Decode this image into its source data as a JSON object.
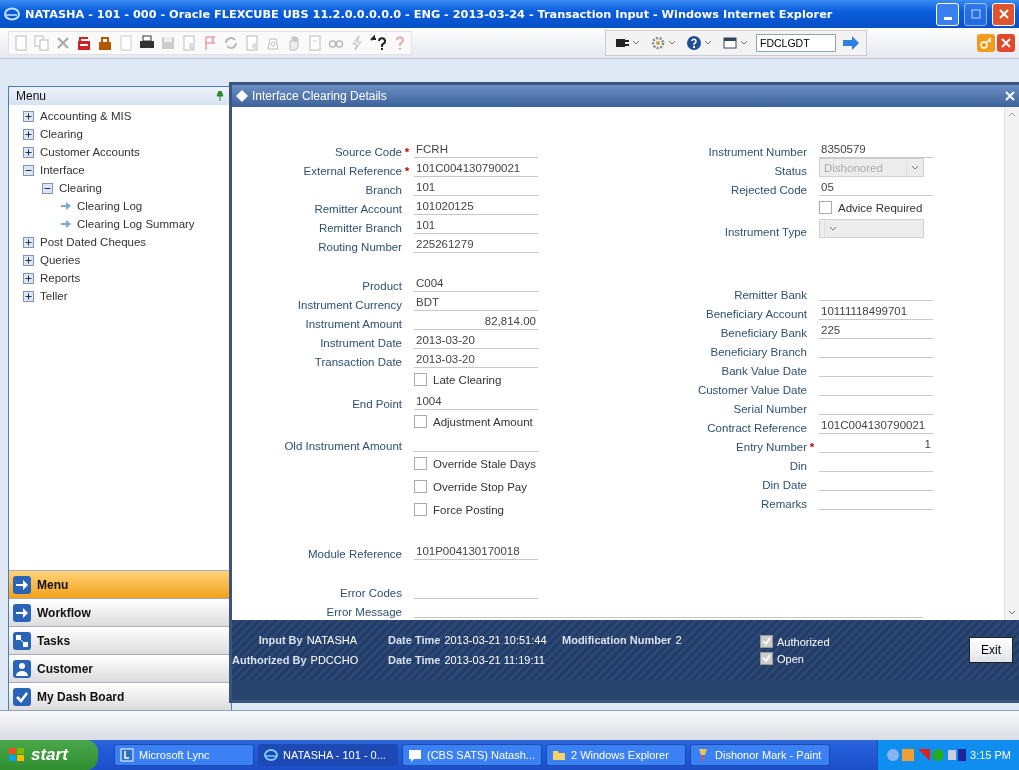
{
  "window": {
    "title": "NATASHA - 101 - 000 - Oracle FLEXCUBE UBS 11.2.0.0.0.0.0 - ENG - 2013-03-24 - Transaction Input - Windows Internet Explorer"
  },
  "toolbar": {
    "function_id": "FDCLGDT"
  },
  "sidebar": {
    "title": "Menu",
    "items": [
      {
        "label": "Accounting & MIS",
        "kind": "folder",
        "expanded": false
      },
      {
        "label": "Clearing",
        "kind": "folder",
        "expanded": false
      },
      {
        "label": "Customer Accounts",
        "kind": "folder",
        "expanded": false
      },
      {
        "label": "Interface",
        "kind": "folder",
        "expanded": true,
        "children": [
          {
            "label": "Clearing",
            "kind": "folder",
            "expanded": true,
            "children": [
              {
                "label": "Clearing Log",
                "kind": "leaf"
              },
              {
                "label": "Clearing Log Summary",
                "kind": "leaf"
              }
            ]
          }
        ]
      },
      {
        "label": "Post Dated Cheques",
        "kind": "folder",
        "expanded": false
      },
      {
        "label": "Queries",
        "kind": "folder",
        "expanded": false
      },
      {
        "label": "Reports",
        "kind": "folder",
        "expanded": false
      },
      {
        "label": "Teller",
        "kind": "folder",
        "expanded": false
      }
    ],
    "nav": [
      {
        "label": "Menu",
        "kind": "arrow",
        "selected": true
      },
      {
        "label": "Workflow",
        "kind": "arrow",
        "selected": false
      },
      {
        "label": "Tasks",
        "kind": "tasks",
        "selected": false
      },
      {
        "label": "Customer",
        "kind": "person",
        "selected": false
      },
      {
        "label": "My Dash Board",
        "kind": "check",
        "selected": false
      }
    ]
  },
  "dialog": {
    "title": "Interface Clearing Details",
    "form": {
      "left": [
        [
          {
            "label": "Source Code",
            "kind": "text",
            "required_mark": "*",
            "value": "FCRH"
          },
          {
            "label": "External Reference",
            "kind": "text",
            "required_mark": "*",
            "value": "101C004130790021"
          },
          {
            "label": "Branch",
            "kind": "text",
            "value": "101"
          },
          {
            "label": "Remitter Account",
            "kind": "text",
            "value": "101020125"
          },
          {
            "label": "Remitter Branch",
            "kind": "text",
            "value": "101"
          },
          {
            "label": "Routing Number",
            "kind": "text",
            "value": "225261279"
          }
        ],
        [
          {
            "label": "Product",
            "kind": "text",
            "value": "C004"
          },
          {
            "label": "Instrument Currency",
            "kind": "text",
            "value": "BDT"
          },
          {
            "label": "Instrument Amount",
            "kind": "amount",
            "value": "82,814.00"
          },
          {
            "label": "Instrument Date",
            "kind": "text",
            "value": "2013-03-20"
          },
          {
            "label": "Transaction Date",
            "kind": "text",
            "value": "2013-03-20"
          },
          {
            "label": "Late Clearing",
            "kind": "checkbox",
            "checked": false
          },
          {
            "label": "End Point",
            "kind": "text",
            "value": "1004"
          },
          {
            "label": "Adjustment Amount",
            "kind": "checkbox",
            "checked": false
          },
          {
            "label": "Old Instrument Amount",
            "kind": "text"
          },
          {
            "label": "Override Stale Days",
            "kind": "checkbox",
            "checked": false
          },
          {
            "label": "Override Stop Pay",
            "kind": "checkbox",
            "checked": false
          },
          {
            "label": "Force Posting",
            "kind": "checkbox",
            "checked": false
          }
        ],
        [
          {
            "label": "Module Reference",
            "kind": "text",
            "value": "101P004130170018"
          }
        ],
        [
          {
            "label": "Error Codes",
            "kind": "text"
          },
          {
            "label": "Error Message",
            "kind": "wide"
          }
        ]
      ],
      "right": [
        [
          {
            "label": "Instrument Number",
            "kind": "text",
            "value": "8350579"
          },
          {
            "label": "Status",
            "kind": "select",
            "disabled": true,
            "value": "Dishonored"
          },
          {
            "label": "Rejected Code",
            "kind": "text",
            "value": "05"
          },
          {
            "label": "Advice Required",
            "kind": "checkbox",
            "checked": false
          },
          {
            "label": "Instrument Type",
            "kind": "select",
            "disabled": true
          }
        ],
        [
          {
            "label": "Remitter Bank",
            "kind": "text"
          },
          {
            "label": "Beneficiary Account",
            "kind": "text",
            "value": "10111118499701"
          },
          {
            "label": "Beneficiary Bank",
            "kind": "text",
            "value": "225"
          },
          {
            "label": "Beneficiary Branch",
            "kind": "text"
          },
          {
            "label": "Bank Value Date",
            "kind": "text"
          },
          {
            "label": "Customer Value Date",
            "kind": "text"
          },
          {
            "label": "Serial Number",
            "kind": "text"
          },
          {
            "label": "Contract Reference",
            "kind": "text",
            "value": "101C004130790021"
          },
          {
            "label": "Entry Number",
            "kind": "amount",
            "required_mark": "*",
            "value": "1"
          },
          {
            "label": "Din",
            "kind": "text"
          },
          {
            "label": "Din Date",
            "kind": "text"
          },
          {
            "label": "Remarks",
            "kind": "text"
          }
        ]
      ]
    },
    "footer": {
      "rows": [
        [
          {
            "label": "Input By",
            "value": "NATASHA"
          },
          {
            "label": "Date Time",
            "value": "2013-03-21 10:51:44"
          },
          {
            "label": "Modification Number",
            "value": "2"
          }
        ],
        [
          {
            "label": "Authorized By",
            "value": "PDCCHO"
          },
          {
            "label": "Date Time",
            "value": "2013-03-21 11:19:11"
          }
        ]
      ],
      "checks": [
        {
          "label": "Authorized",
          "checked": true
        },
        {
          "label": "Open",
          "checked": true
        }
      ],
      "button": "Exit"
    }
  },
  "taskbar": {
    "start": "start",
    "tasks": [
      {
        "label": "Microsoft Lync",
        "kind": "lync",
        "selected": false
      },
      {
        "label": "NATASHA - 101 - 0...",
        "kind": "browser",
        "selected": true
      },
      {
        "label": "(CBS SATS) Natash...",
        "kind": "chat",
        "selected": false
      },
      {
        "label": "2 Windows Explorer",
        "kind": "folder",
        "selected": false
      },
      {
        "label": "Dishonor Mark - Paint",
        "kind": "paint",
        "selected": false
      }
    ],
    "clock": "3:15 PM"
  }
}
